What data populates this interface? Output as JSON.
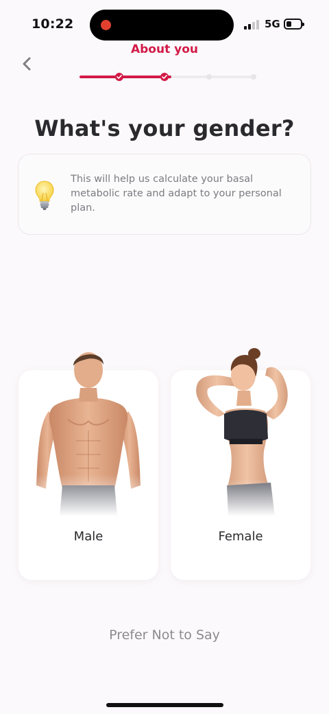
{
  "status_bar": {
    "time": "10:22",
    "network": "5G",
    "recording_color": "#e2402f"
  },
  "header": {
    "back_icon": "chevron-left-icon",
    "section_title": "About you",
    "progress": {
      "total_steps": 4,
      "completed_steps": 2,
      "active_color": "#d21a47",
      "inactive_color": "#ececee"
    }
  },
  "question": {
    "title": "What's your gender?"
  },
  "info_card": {
    "icon": "lightbulb-icon",
    "text": "This will help us calculate your basal metabolic rate and adapt to your personal plan."
  },
  "options": [
    {
      "id": "male",
      "label": "Male",
      "icon": "male-figure-image"
    },
    {
      "id": "female",
      "label": "Female",
      "icon": "female-figure-image"
    }
  ],
  "prefer_not_label": "Prefer Not to Say",
  "colors": {
    "accent": "#d21a47",
    "background": "#fbf9fb",
    "card": "#ffffff"
  }
}
